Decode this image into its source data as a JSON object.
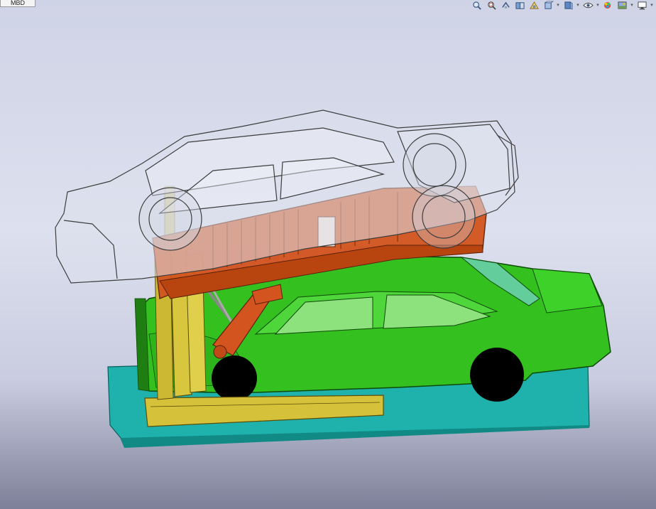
{
  "document": {
    "tab_label": "MBD"
  },
  "toolbar": {
    "buttons": [
      {
        "icon": "zoom-to-fit-icon"
      },
      {
        "icon": "zoom-to-area-icon"
      },
      {
        "icon": "previous-view-icon"
      },
      {
        "icon": "section-view-icon"
      },
      {
        "icon": "dynamic-annotation-icon"
      },
      {
        "icon": "view-orientation-icon"
      },
      {
        "icon": "display-style-icon"
      },
      {
        "icon": "hide-show-items-icon"
      },
      {
        "icon": "edit-appearance-icon"
      },
      {
        "icon": "apply-scene-icon"
      },
      {
        "icon": "view-settings-icon"
      }
    ]
  },
  "model": {
    "colors": {
      "base_plate": "#20b2ad",
      "lower_car": "#33c11f",
      "platform": "#d3541e",
      "lift_frame": "#d8c53a",
      "upper_car_outline": "#4a4a4a"
    }
  }
}
